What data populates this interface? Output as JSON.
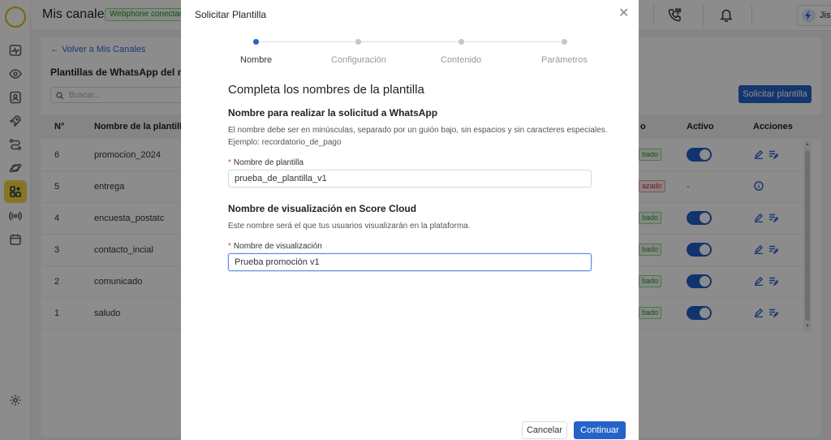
{
  "app": {
    "title": "Mis canales",
    "status_badge": "Webphone conectado",
    "user_name": "Jisell"
  },
  "background": {
    "back_link": "Volver a Mis Canales",
    "page_heading": "Plantillas de WhatsApp del núme",
    "search_placeholder": "Buscar...",
    "request_button": "Solicitar plantilla",
    "columns": [
      "N°",
      "Nombre de la plantilla",
      "o",
      "Activo",
      "Acciones"
    ],
    "rows": [
      {
        "num": "6",
        "name": "promocion_2024",
        "status": "bado",
        "status_type": "approved",
        "active": true
      },
      {
        "num": "5",
        "name": "entrega",
        "status": "azado",
        "status_type": "rejected",
        "active": null,
        "active_text": "-"
      },
      {
        "num": "4",
        "name": "encuesta_postatc",
        "status": "bado",
        "status_type": "approved",
        "active": true
      },
      {
        "num": "3",
        "name": "contacto_incial",
        "status": "bado",
        "status_type": "approved",
        "active": true
      },
      {
        "num": "2",
        "name": "comunicado",
        "status": "bado",
        "status_type": "approved",
        "active": true
      },
      {
        "num": "1",
        "name": "saludo",
        "status": "bado",
        "status_type": "approved",
        "active": true
      }
    ]
  },
  "modal": {
    "title": "Solicitar Plantilla",
    "steps": [
      "Nombre",
      "Configuración",
      "Contenido",
      "Parámetros"
    ],
    "active_step": 0,
    "section_title": "Completa los nombres de la plantilla",
    "whatsapp_name": {
      "heading": "Nombre para realizar la solicitud a WhatsApp",
      "description_line1": "El nombre debe ser en minúsculas, separado por un guión bajo, sin espacios y sin caracteres especiales.",
      "description_line2": "Ejemplo: recordatorio_de_pago",
      "label": "Nombre de plantilla",
      "value": "prueba_de_plantilla_v1"
    },
    "display_name": {
      "heading": "Nombre de visualización en Score Cloud",
      "description": "Este nombre será el que tus usuarios visualizarán en la plataforma.",
      "label": "Nombre de visualización",
      "value": "Prueba promoción v1"
    },
    "cancel_label": "Cancelar",
    "continue_label": "Continuar"
  },
  "colors": {
    "accent": "#2563c9",
    "sidebar_active": "#f6d548",
    "overlay": "rgba(0,0,0,0.45)"
  },
  "icons": {
    "sidebar": [
      "logo-ring-icon",
      "activity-icon",
      "eye-icon",
      "contact-card-icon",
      "rocket-icon",
      "routes-icon",
      "planet-icon",
      "apps-grid-icon",
      "broadcast-icon",
      "calendar-icon",
      "settings-icon"
    ],
    "topbar": [
      "dialpad-phone-icon",
      "bell-icon",
      "bolt-icon",
      "chevron-down-icon"
    ]
  }
}
